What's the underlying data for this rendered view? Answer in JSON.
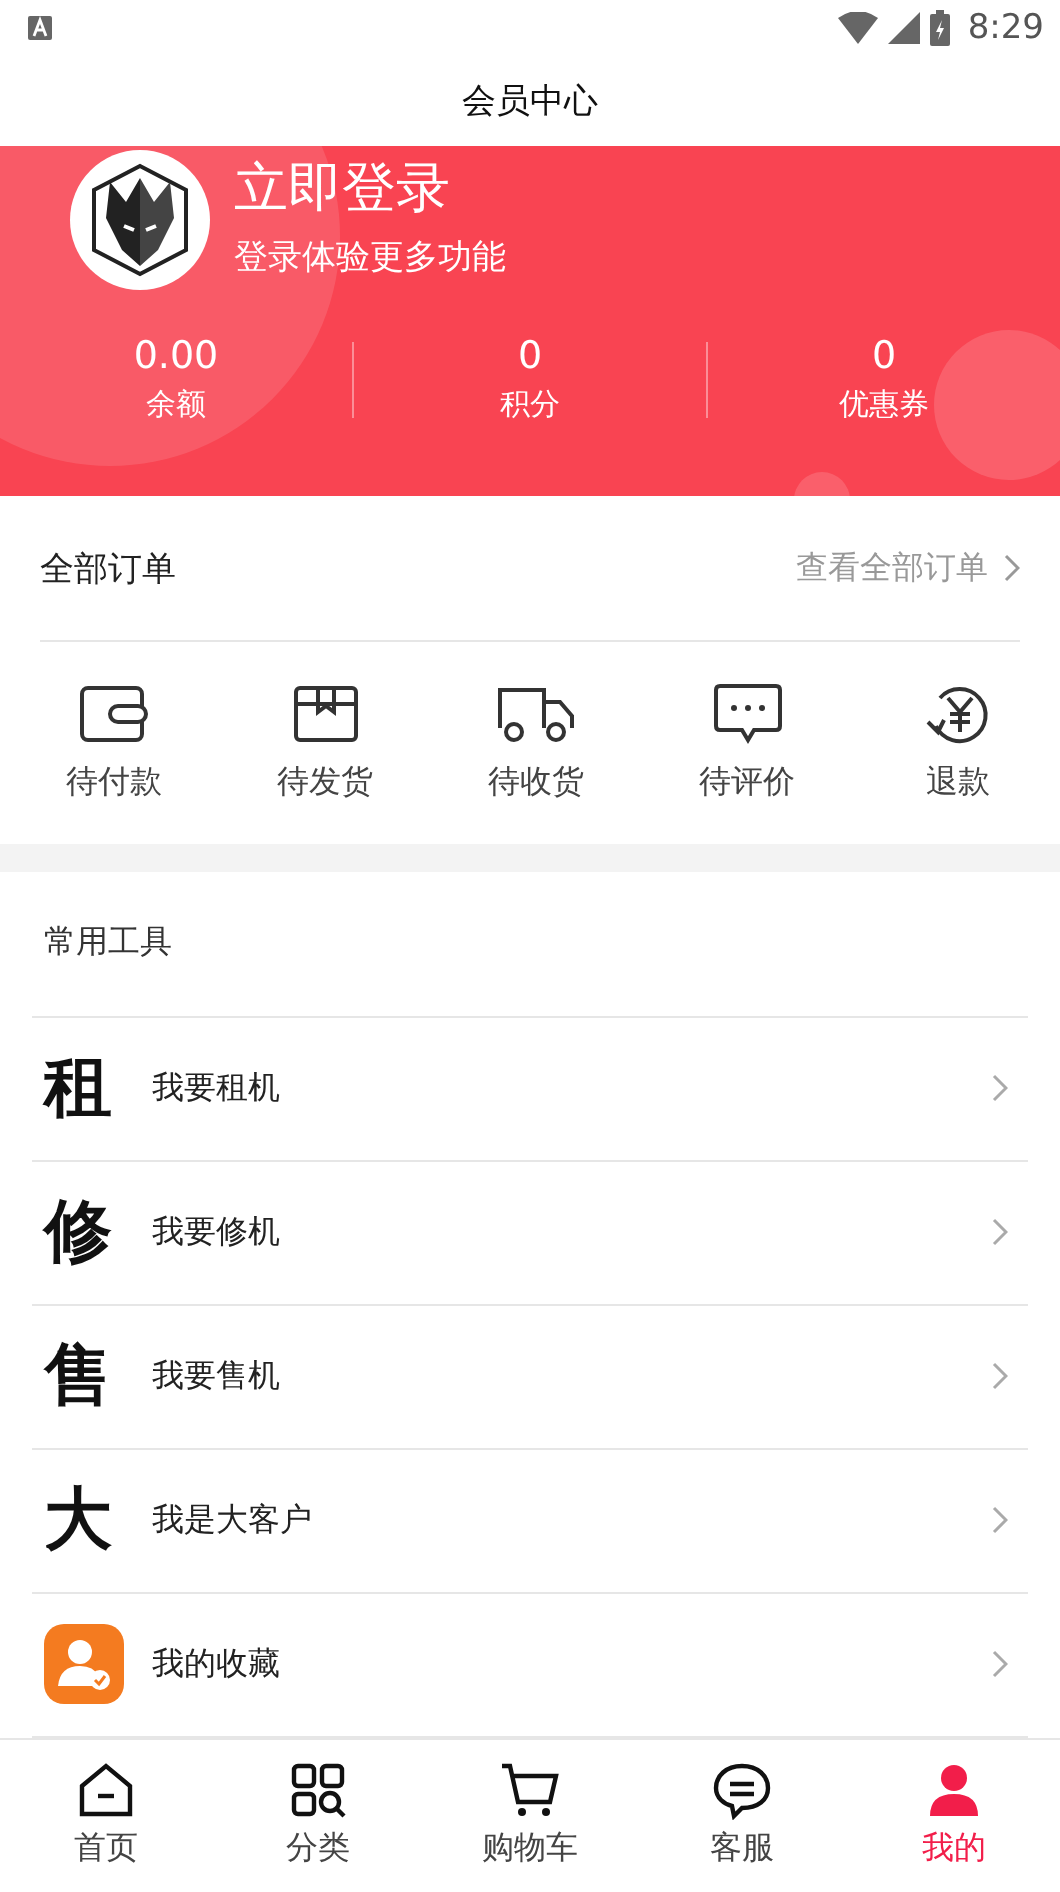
{
  "status_bar": {
    "time": "8:29"
  },
  "title": "会员中心",
  "profile": {
    "name": "立即登录",
    "subtitle": "登录体验更多功能"
  },
  "stats": [
    {
      "value": "0.00",
      "label": "余额"
    },
    {
      "value": "0",
      "label": "积分"
    },
    {
      "value": "0",
      "label": "优惠券"
    }
  ],
  "orders": {
    "title": "全部订单",
    "link": "查看全部订单",
    "items": [
      {
        "label": "待付款"
      },
      {
        "label": "待发货"
      },
      {
        "label": "待收货"
      },
      {
        "label": "待评价"
      },
      {
        "label": "退款"
      }
    ]
  },
  "tools": {
    "title": "常用工具",
    "items": [
      {
        "kind": "glyph",
        "glyph": "租",
        "label": "我要租机"
      },
      {
        "kind": "glyph",
        "glyph": "修",
        "label": "我要修机"
      },
      {
        "kind": "glyph",
        "glyph": "售",
        "label": "我要售机"
      },
      {
        "kind": "glyph",
        "glyph": "大",
        "label": "我是大客户"
      },
      {
        "kind": "badge",
        "label": "我的收藏"
      }
    ]
  },
  "tabbar": [
    {
      "label": "首页",
      "selected": false
    },
    {
      "label": "分类",
      "selected": false
    },
    {
      "label": "购物车",
      "selected": false
    },
    {
      "label": "客服",
      "selected": false
    },
    {
      "label": "我的",
      "selected": true
    }
  ]
}
